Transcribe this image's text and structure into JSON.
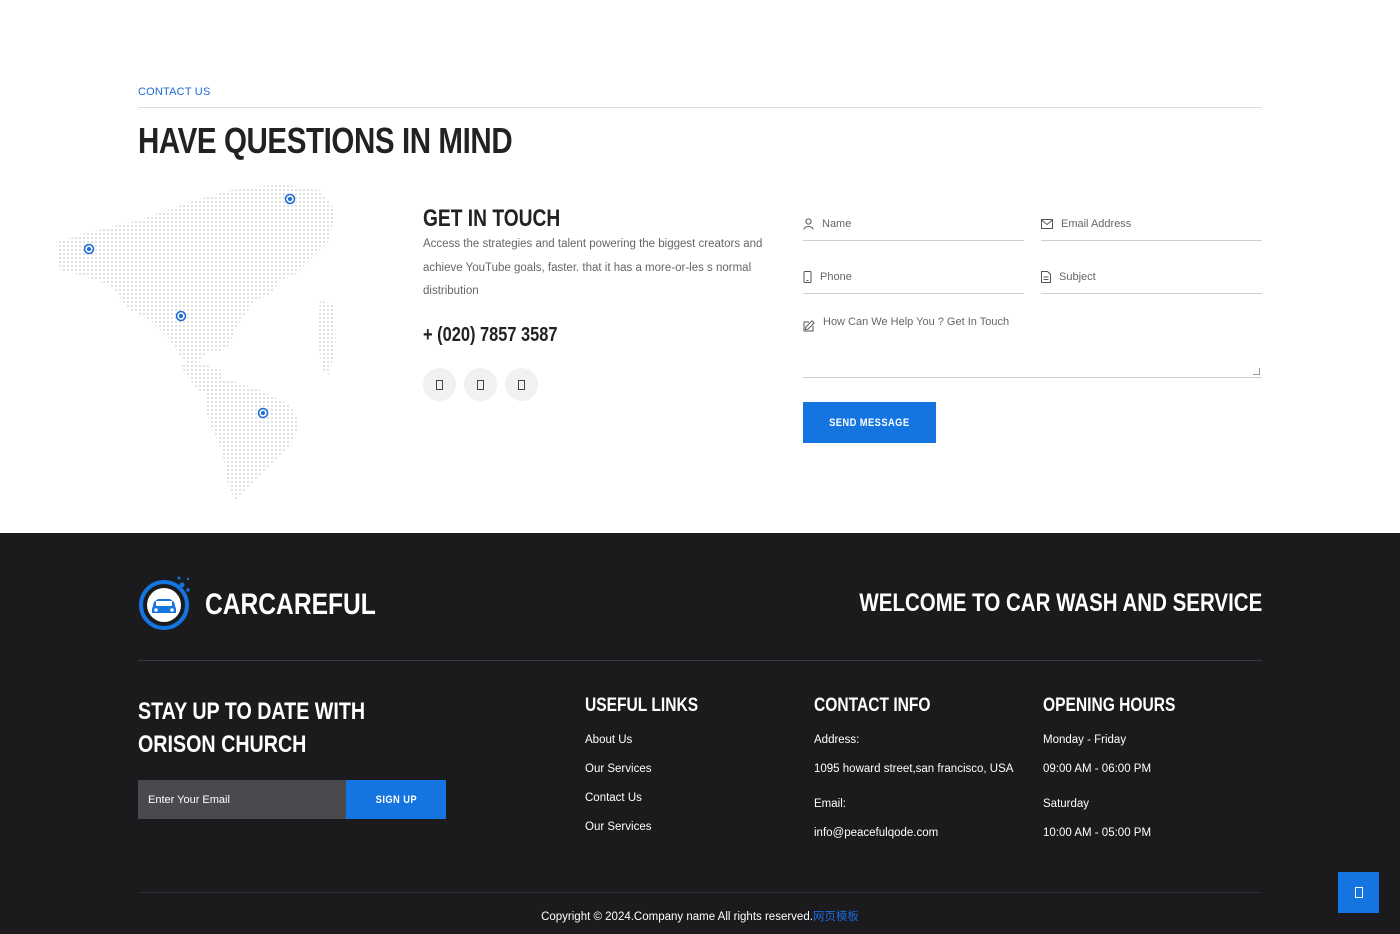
{
  "contact": {
    "eyebrow": "CONTACT US",
    "title": "HAVE QUESTIONS IN MIND",
    "get_in_touch": {
      "title": "GET IN TOUCH",
      "description": "Access the strategies and talent powering the biggest creators and achieve YouTube goals, faster. that it has a more-or-les s normal distribution",
      "phone": "+ (020) 7857 3587",
      "social_icons": [
        "social-icon-1",
        "social-icon-2",
        "social-icon-3"
      ]
    },
    "form": {
      "name_placeholder": "Name",
      "email_placeholder": "Email Address",
      "phone_placeholder": "Phone",
      "subject_placeholder": "Subject",
      "message_placeholder": "How Can We Help You ? Get In Touch",
      "send_label": "SEND MESSAGE"
    }
  },
  "footer": {
    "brand": "CARCAREFUL",
    "welcome": "WELCOME TO CAR WASH AND SERVICE",
    "newsletter": {
      "title_line1": "STAY UP TO DATE WITH",
      "title_line2": "ORISON CHURCH",
      "email_placeholder": "Enter Your Email",
      "signup_label": "SIGN UP"
    },
    "useful_links": {
      "title": "USEFUL LINKS",
      "items": [
        "About Us",
        "Our Services",
        "Contact Us",
        "Our Services"
      ]
    },
    "contact_info": {
      "title": "CONTACT INFO",
      "address_label": "Address:",
      "address": "1095 howard street,san francisco, USA",
      "email_label": "Email:",
      "email": "info@peacefulqode.com"
    },
    "opening_hours": {
      "title": "OPENING HOURS",
      "weekday_label": "Monday - Friday",
      "weekday_hours": "09:00 AM - 06:00 PM",
      "weekend_label": "Saturday",
      "weekend_hours": "10:00 AM - 05:00 PM"
    },
    "copyright": "Copyright © 2024.Company name All rights reserved.",
    "copyright_link": "网页模板"
  },
  "colors": {
    "accent": "#1474e0",
    "footer_bg": "#1b1b1e"
  }
}
